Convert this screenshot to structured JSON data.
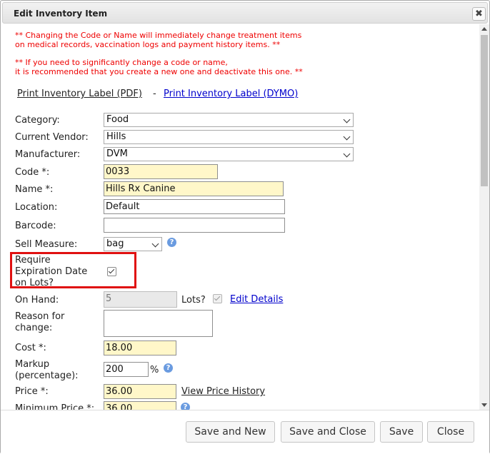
{
  "dialog": {
    "title": "Edit Inventory Item",
    "close_glyph": "✖"
  },
  "warnings": {
    "line1": "** Changing the Code or Name will immediately change treatment items",
    "line2": "on medical records, vaccination logs and payment history items. **",
    "line3": "** If you need to significantly change a code or name,",
    "line4": "it is recommended that you create a new one and deactivate this one. **"
  },
  "links": {
    "print_pdf": "Print Inventory Label (PDF)",
    "separator": "-",
    "print_dymo": "Print Inventory Label (DYMO)"
  },
  "form": {
    "category": {
      "label": "Category:",
      "value": "Food"
    },
    "vendor": {
      "label": "Current Vendor:",
      "value": "Hills"
    },
    "manufacturer": {
      "label": "Manufacturer:",
      "value": "DVM"
    },
    "code": {
      "label": "Code *:",
      "value": "0033"
    },
    "name": {
      "label": "Name *:",
      "value": "Hills Rx Canine"
    },
    "location": {
      "label": "Location:",
      "value": "Default"
    },
    "barcode": {
      "label": "Barcode:",
      "value": ""
    },
    "sell_measure": {
      "label": "Sell Measure:",
      "value": "bag"
    },
    "require_exp": {
      "label_line1": "Require",
      "label_line2": "Expiration Date",
      "label_line3": "on Lots?",
      "checked": true
    },
    "on_hand": {
      "label": "On Hand:",
      "value": "5",
      "lots_label": "Lots?",
      "lots_checked": true,
      "edit_link": "Edit Details"
    },
    "reason": {
      "label_line1": "Reason for",
      "label_line2": "change:",
      "value": ""
    },
    "cost": {
      "label": "Cost *:",
      "value": "18.00"
    },
    "markup": {
      "label_line1": "Markup",
      "label_line2": "(percentage):",
      "value": "200",
      "unit": "%"
    },
    "price": {
      "label": "Price *:",
      "value": "36.00",
      "history_link": "View Price History"
    },
    "minimum_price": {
      "label": "Minimum Price *:",
      "value": "36.00"
    }
  },
  "help_glyph": "?",
  "buttons": {
    "save_and_new": "Save and New",
    "save_and_close": "Save and Close",
    "save": "Save",
    "close": "Close"
  },
  "colors": {
    "warning": "#ee0000",
    "link": "#0000cc",
    "required_field": "#fff7c9",
    "highlight_box": "#e01010"
  }
}
